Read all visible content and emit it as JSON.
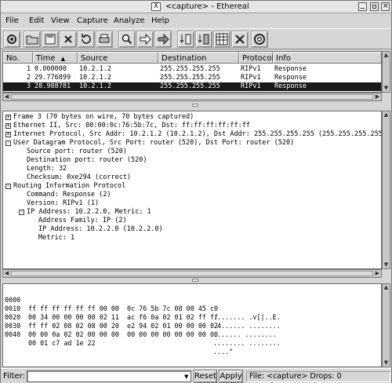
{
  "window": {
    "title": "<capture> - Ethereal",
    "x_glyph": "X"
  },
  "menu": [
    "File",
    "Edit",
    "View",
    "Capture",
    "Analyze",
    "Help"
  ],
  "toolbar": [
    {
      "icon": "capture-start-icon"
    },
    {
      "icon": "open-folder-icon"
    },
    {
      "icon": "save-icon"
    },
    {
      "icon": "close-icon"
    },
    {
      "icon": "reload-icon"
    },
    {
      "icon": "print-icon"
    },
    {
      "icon": "find-icon"
    },
    {
      "icon": "go-forward-icon"
    },
    {
      "icon": "go-to-packet-icon"
    },
    {
      "icon": "display-filter-icon"
    },
    {
      "icon": "capture-filter-icon"
    },
    {
      "icon": "coloring-rules-icon"
    },
    {
      "icon": "preferences-icon"
    },
    {
      "icon": "help-icon"
    }
  ],
  "packet_list": {
    "columns": [
      "No.",
      "Time",
      "Source",
      "Destination",
      "Protocol",
      "Info"
    ],
    "rows": [
      {
        "no": "1",
        "time": "0.000000",
        "source": "10.2.1.2",
        "destination": "255.255.255.255",
        "protocol": "RIPv1",
        "info": "Response",
        "selected": false
      },
      {
        "no": "2",
        "time": "29.776899",
        "source": "10.2.1.2",
        "destination": "255.255.255.255",
        "protocol": "RIPv1",
        "info": "Response",
        "selected": false
      },
      {
        "no": "3",
        "time": "28.988781",
        "source": "10.2.1.2",
        "destination": "255.255.255.255",
        "protocol": "RIPv1",
        "info": "Response",
        "selected": true
      }
    ]
  },
  "detail_tree": [
    {
      "text": "Frame 3 (70 bytes on wire, 70 bytes captured)",
      "level": 0,
      "expander": "+"
    },
    {
      "text": "Ethernet II, Src: 00:00:0c:76:5b:7c, Dst: ff:ff:ff:ff:ff:ff",
      "level": 0,
      "expander": "+"
    },
    {
      "text": "Internet Protocol, Src Addr: 10.2.1.2 (10.2.1.2), Dst Addr: 255.255.255.255 (255.255.255.255)",
      "level": 0,
      "expander": "+"
    },
    {
      "text": "User Datagram Protocol, Src Port: router (520), Dst Port: router (520)",
      "level": 0,
      "expander": "-"
    },
    {
      "text": "Source port: router (520)",
      "level": 1,
      "expander": ""
    },
    {
      "text": "Destination port: router (520)",
      "level": 1,
      "expander": ""
    },
    {
      "text": "Length: 32",
      "level": 1,
      "expander": ""
    },
    {
      "text": "Checksum: 0xe294 (correct)",
      "level": 1,
      "expander": ""
    },
    {
      "text": "Routing Information Protocol",
      "level": 0,
      "expander": "-"
    },
    {
      "text": "Command: Response (2)",
      "level": 1,
      "expander": ""
    },
    {
      "text": "Version: RIPv1 (1)",
      "level": 1,
      "expander": ""
    },
    {
      "text": "IP Address: 10.2.2.0, Metric: 1",
      "level": 1,
      "expander": "-"
    },
    {
      "text": "Address Family: IP (2)",
      "level": 2,
      "expander": ""
    },
    {
      "text": "IP Address: 10.2.2.0 (10.2.2.0)",
      "level": 2,
      "expander": ""
    },
    {
      "text": "Metric: 1",
      "level": 2,
      "expander": ""
    }
  ],
  "hex_dump": [
    {
      "offset": "0000",
      "bytes": "ff ff ff ff ff ff 00 00  0c 76 5b 7c 08 00 45 c0",
      "ascii": "........ .v[|..E."
    },
    {
      "offset": "0010",
      "bytes": "00 34 00 00 00 00 02 11  ac f6 0a 02 01 02 ff ff",
      "ascii": ".4...... ........"
    },
    {
      "offset": "0020",
      "bytes": "ff ff 02 08 02 08 00 20  e2 94 02 01 00 00 00 02",
      "ascii": "....... ........"
    },
    {
      "offset": "0030",
      "bytes": "00 00 0a 02 02 00 00 00  00 00 00 00 00 00 00 00",
      "ascii": "........ ........"
    },
    {
      "offset": "0040",
      "bytes": "00 01 c7 ad 1e 22",
      "ascii": "....\""
    }
  ],
  "statusbar": {
    "filter_label": "Filter:",
    "filter_value": "",
    "reset_label": "Reset",
    "apply_label": "Apply",
    "status_text": "File: <capture>  Drops: 0"
  }
}
